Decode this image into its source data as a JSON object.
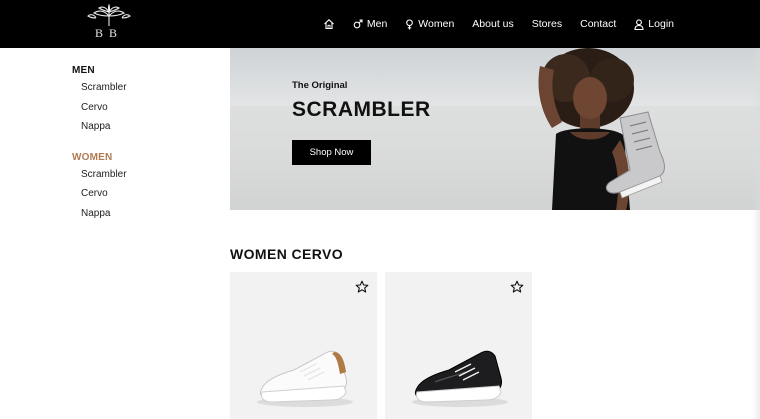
{
  "brand": {
    "logo_text": "BB",
    "logo_icon": "tree-logo-icon"
  },
  "nav": {
    "items": [
      {
        "label": "",
        "icon": "home-icon"
      },
      {
        "label": "Men",
        "icon": "male-icon"
      },
      {
        "label": "Women",
        "icon": "female-icon"
      },
      {
        "label": "About us",
        "icon": ""
      },
      {
        "label": "Stores",
        "icon": ""
      },
      {
        "label": "Contact",
        "icon": ""
      },
      {
        "label": "Login",
        "icon": "user-icon"
      }
    ]
  },
  "sidebar": {
    "groups": [
      {
        "heading": "MEN",
        "items": [
          "Scrambler",
          "Cervo",
          "Nappa"
        ]
      },
      {
        "heading": "WOMEN",
        "items": [
          "Scrambler",
          "Cervo",
          "Nappa"
        ]
      }
    ]
  },
  "hero": {
    "subtitle": "The Original",
    "title": "SCRAMBLER",
    "button_label": "Shop Now"
  },
  "section": {
    "title": "WOMEN CERVO"
  },
  "products": [
    {
      "shoe_color": "white",
      "favorite_icon": "star-outline-icon"
    },
    {
      "shoe_color": "black",
      "favorite_icon": "star-outline-icon"
    }
  ],
  "colors": {
    "topbar": "#000000",
    "accent_women": "#b07a52",
    "button_bg": "#000000",
    "card_bg": "#f2f2f2"
  }
}
